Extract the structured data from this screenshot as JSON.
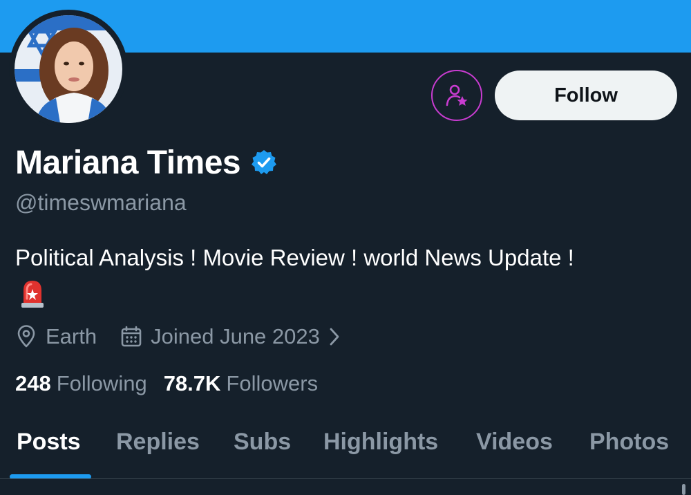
{
  "profile": {
    "display_name": "Mariana Times",
    "handle": "@timeswmariana",
    "verified": true,
    "bio": "Political Analysis ! Movie Review ! world News Update !",
    "bio_emoji": "rotating-light-icon",
    "location": "Earth",
    "joined": "Joined June 2023"
  },
  "stats": {
    "following_count": "248",
    "following_label": "Following",
    "followers_count": "78.7K",
    "followers_label": "Followers"
  },
  "actions": {
    "follow_label": "Follow",
    "subscribe_icon": "user-star-icon"
  },
  "tabs": [
    {
      "label": "Posts",
      "active": true
    },
    {
      "label": "Replies",
      "active": false
    },
    {
      "label": "Subs",
      "active": false
    },
    {
      "label": "Highlights",
      "active": false
    },
    {
      "label": "Videos",
      "active": false
    },
    {
      "label": "Photos",
      "active": false
    }
  ],
  "colors": {
    "background": "#15202b",
    "banner": "#1d9bf0",
    "accent": "#1d9bf0",
    "subscribe_accent": "#c93cd1",
    "secondary_text": "#8b98a5"
  }
}
